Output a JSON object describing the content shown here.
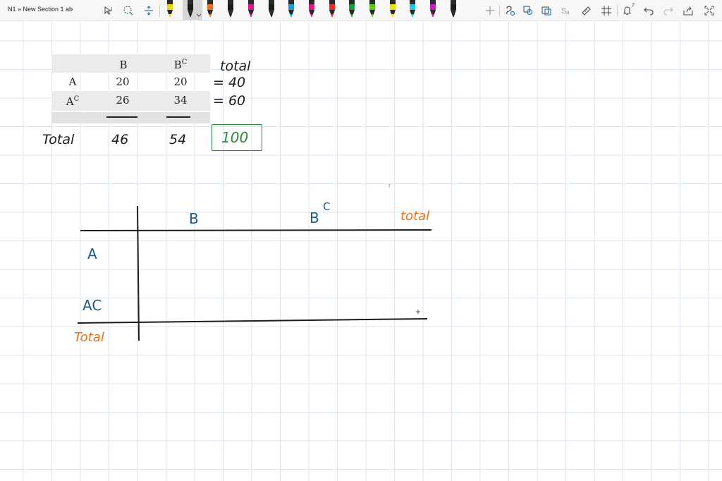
{
  "breadcrumb": "N1 » New Section 1 ab",
  "toolbar": {
    "tools": [
      "select-text-icon",
      "lasso-select-icon",
      "add-space-icon"
    ],
    "pens": [
      {
        "color": "#f5d400"
      },
      {
        "color": "#1a1a1a"
      },
      {
        "color": "#e8731a"
      },
      {
        "color": "#1a1a1a"
      },
      {
        "color": "#d8198d"
      },
      {
        "color": "#1a1a1a"
      },
      {
        "color": "#1a9cd8"
      },
      {
        "color": "#d81a8a"
      },
      {
        "color": "#e03030"
      },
      {
        "color": "#1a9c3a"
      },
      {
        "color": "#55c81a"
      },
      {
        "color": "#f0e000"
      },
      {
        "color": "#1ac8e0"
      },
      {
        "color": "#c81ac8"
      },
      {
        "color": "#1a1a1a"
      }
    ],
    "right_tools": [
      "add-pen-icon",
      "ink-to-shape-icon",
      "ink-to-text-icon",
      "ink-to-math-icon",
      "replay-icon",
      "ruler-icon",
      "snap-grid-icon",
      "notification-icon",
      "undo-icon",
      "redo-icon",
      "share-icon",
      "fullscreen-icon"
    ],
    "notification_count": "2"
  },
  "image_table": {
    "header": [
      "",
      "B",
      "B",
      "C"
    ],
    "rows": [
      {
        "label": "A",
        "sup": "",
        "b": "20",
        "bc": "20"
      },
      {
        "label": "A",
        "sup": "C",
        "b": "26",
        "bc": "34"
      }
    ]
  },
  "handwriting": {
    "total_header": "total",
    "row1_total": "= 40",
    "row2_total": "= 60",
    "total_label": "Total",
    "col_b_total": "46",
    "col_bc_total": "54",
    "grand_total": "100",
    "small_mark": "r"
  },
  "drawn_table": {
    "col_b": "B",
    "col_bc": "B",
    "col_bc_sup": "C",
    "col_total": "total",
    "row_a": "A",
    "row_ac": "AC",
    "row_total": "Total"
  }
}
